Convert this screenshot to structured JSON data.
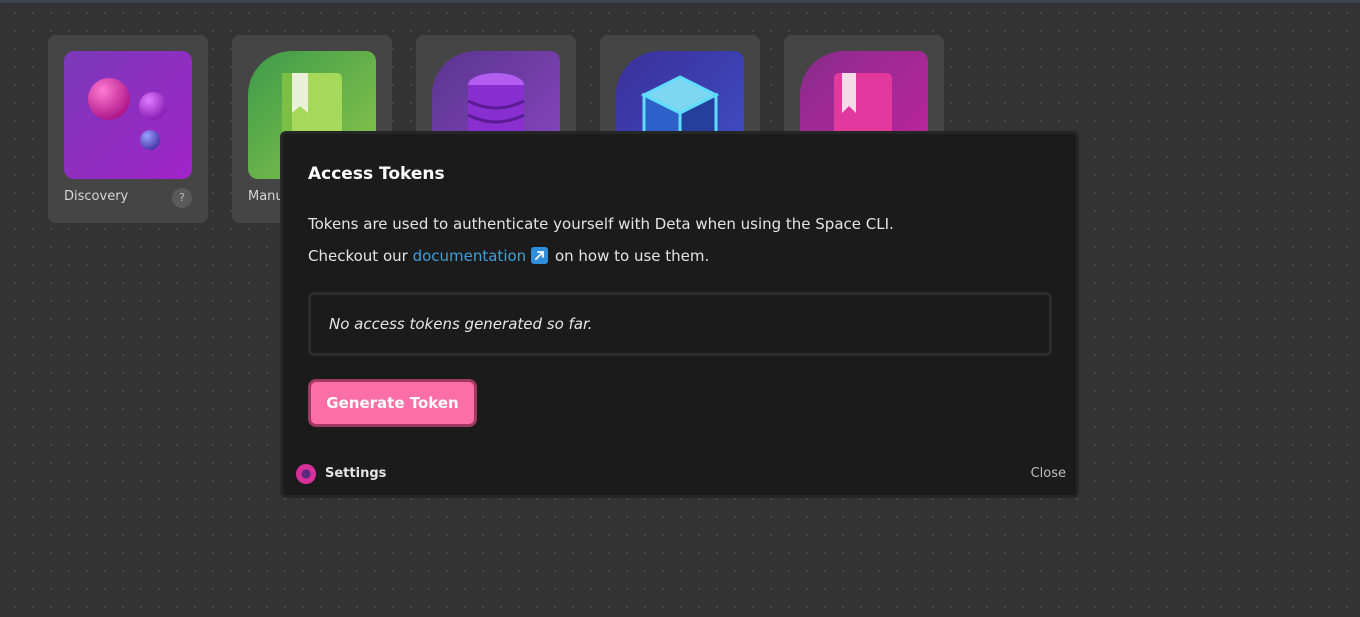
{
  "tiles": [
    {
      "label": "Discovery",
      "help": "?"
    },
    {
      "label": "Manu"
    },
    {
      "label": ""
    },
    {
      "label": ""
    },
    {
      "label": ""
    }
  ],
  "modal": {
    "title": "Access Tokens",
    "desc_line1": "Tokens are used to authenticate yourself with Deta when using the Space CLI.",
    "desc_prefix": "Checkout our ",
    "doc_link": "documentation",
    "desc_suffix": " on how to use them.",
    "empty_message": "No access tokens generated so far.",
    "generate_button": "Generate Token",
    "footer_app": "Settings",
    "close": "Close"
  },
  "colors": {
    "accent_pink": "#fb6fa6",
    "link_blue": "#3f9fd8",
    "modal_bg": "#1b1b1b",
    "canvas_bg": "#333333"
  }
}
